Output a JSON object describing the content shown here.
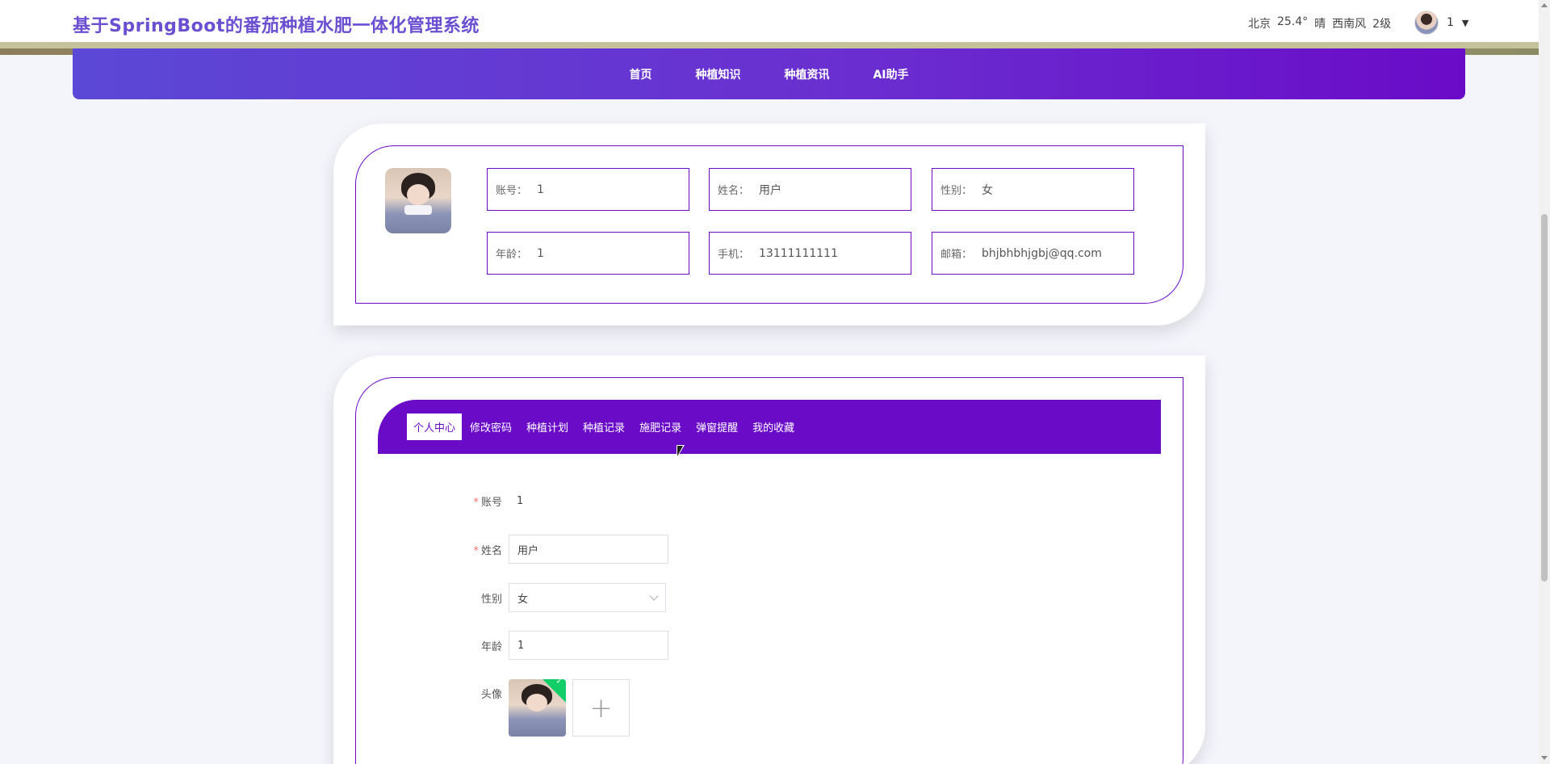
{
  "header": {
    "title": "基于SpringBoot的番茄种植水肥一体化管理系统",
    "weather": {
      "city": "北京",
      "temperature": "25.4°",
      "condition": "晴",
      "wind": "西南风",
      "wind_level": "2级"
    },
    "user": {
      "name": "1"
    }
  },
  "nav": {
    "items": [
      {
        "label": "首页"
      },
      {
        "label": "种植知识"
      },
      {
        "label": "种植资讯"
      },
      {
        "label": "AI助手"
      }
    ]
  },
  "info": {
    "account": {
      "label": "账号：",
      "value": "1"
    },
    "name": {
      "label": "姓名：",
      "value": "用户"
    },
    "gender": {
      "label": "性别：",
      "value": "女"
    },
    "age": {
      "label": "年龄：",
      "value": "1"
    },
    "phone": {
      "label": "手机：",
      "value": "13111111111"
    },
    "email": {
      "label": "邮箱：",
      "value": "bhjbhbhjgbj@qq.com"
    }
  },
  "tabs": {
    "items": [
      {
        "label": "个人中心",
        "active": true
      },
      {
        "label": "修改密码"
      },
      {
        "label": "种植计划"
      },
      {
        "label": "种植记录"
      },
      {
        "label": "施肥记录"
      },
      {
        "label": "弹窗提醒"
      },
      {
        "label": "我的收藏"
      }
    ]
  },
  "form": {
    "account": {
      "label": "账号",
      "required": true,
      "value": "1"
    },
    "name": {
      "label": "姓名",
      "required": true,
      "value": "用户"
    },
    "gender": {
      "label": "性别",
      "value": "女"
    },
    "age": {
      "label": "年龄",
      "value": "1"
    },
    "avatar": {
      "label": "头像",
      "add_icon": "plus-icon"
    }
  },
  "colors": {
    "brand": "#6a0bc8",
    "title": "#6a4fd0",
    "required": "#f56c6c",
    "success": "#13ce66"
  }
}
